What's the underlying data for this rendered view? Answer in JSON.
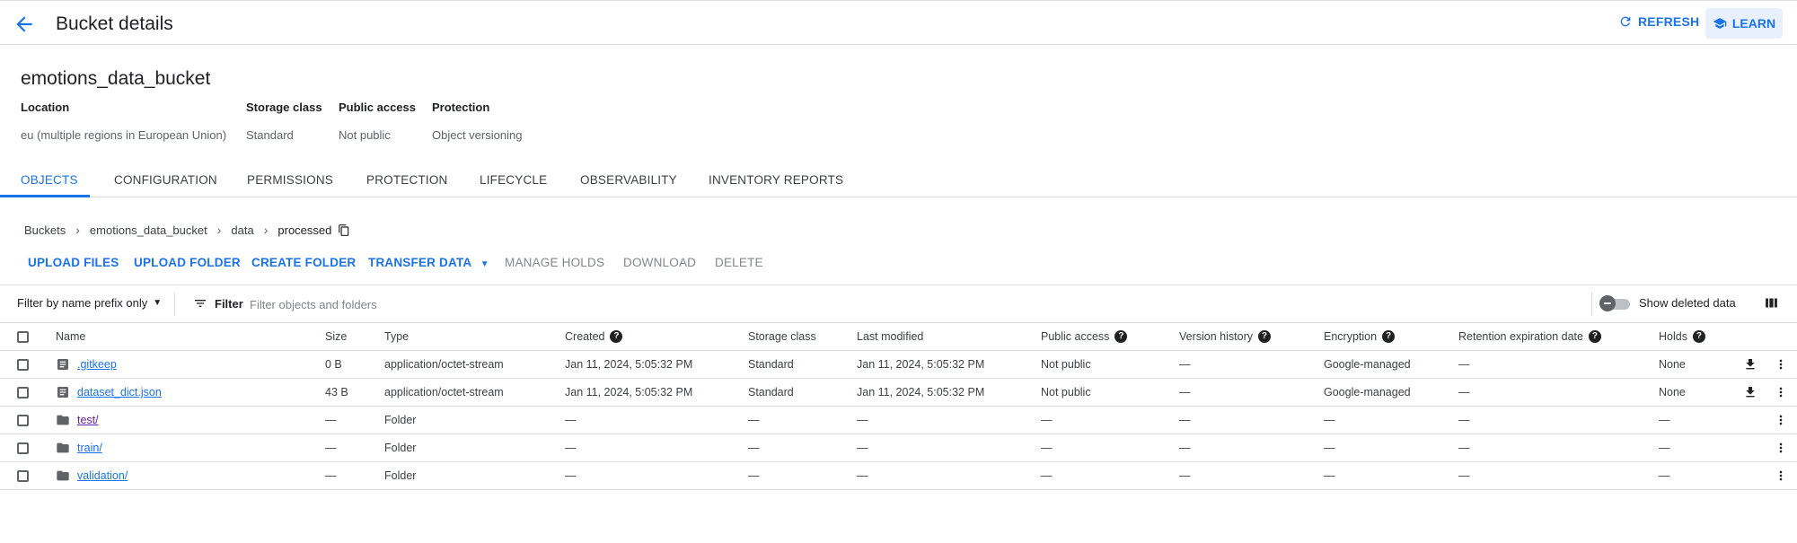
{
  "header": {
    "title": "Bucket details",
    "refresh_label": "REFRESH",
    "learn_label": "LEARN"
  },
  "bucket": {
    "name": "emotions_data_bucket",
    "location_label": "Location",
    "location_value": "eu (multiple regions in European Union)",
    "storage_class_label": "Storage class",
    "storage_class_value": "Standard",
    "public_access_label": "Public access",
    "public_access_value": "Not public",
    "protection_label": "Protection",
    "protection_value": "Object versioning"
  },
  "tabs": [
    {
      "label": "OBJECTS",
      "active": true
    },
    {
      "label": "CONFIGURATION"
    },
    {
      "label": "PERMISSIONS"
    },
    {
      "label": "PROTECTION"
    },
    {
      "label": "LIFECYCLE"
    },
    {
      "label": "OBSERVABILITY"
    },
    {
      "label": "INVENTORY REPORTS"
    }
  ],
  "breadcrumb": [
    "Buckets",
    "emotions_data_bucket",
    "data",
    "processed"
  ],
  "actions": {
    "upload_files": "UPLOAD FILES",
    "upload_folder": "UPLOAD FOLDER",
    "create_folder": "CREATE FOLDER",
    "transfer_data": "TRANSFER DATA",
    "manage_holds": "MANAGE HOLDS",
    "download": "DOWNLOAD",
    "delete": "DELETE"
  },
  "filter": {
    "prefix_label": "Filter by name prefix only",
    "filter_label": "Filter",
    "placeholder": "Filter objects and folders",
    "show_deleted_label": "Show deleted data"
  },
  "table": {
    "columns": [
      "Name",
      "Size",
      "Type",
      "Created",
      "Storage class",
      "Last modified",
      "Public access",
      "Version history",
      "Encryption",
      "Retention expiration date",
      "Holds"
    ],
    "rows": [
      {
        "name": ".gitkeep",
        "kind": "file",
        "size": "0 B",
        "type": "application/octet-stream",
        "created": "Jan 11, 2024, 5:05:32 PM",
        "storage_class": "Standard",
        "last_modified": "Jan 11, 2024, 5:05:32 PM",
        "public_access": "Not public",
        "version_history": "—",
        "encryption": "Google-managed",
        "retention": "—",
        "holds": "None"
      },
      {
        "name": "dataset_dict.json",
        "kind": "file",
        "size": "43 B",
        "type": "application/octet-stream",
        "created": "Jan 11, 2024, 5:05:32 PM",
        "storage_class": "Standard",
        "last_modified": "Jan 11, 2024, 5:05:32 PM",
        "public_access": "Not public",
        "version_history": "—",
        "encryption": "Google-managed",
        "retention": "—",
        "holds": "None"
      },
      {
        "name": "test/",
        "kind": "folder",
        "size": "—",
        "type": "Folder",
        "created": "—",
        "storage_class": "—",
        "last_modified": "—",
        "public_access": "—",
        "version_history": "—",
        "encryption": "—",
        "retention": "—",
        "holds": "—"
      },
      {
        "name": "train/",
        "kind": "folder",
        "size": "—",
        "type": "Folder",
        "created": "—",
        "storage_class": "—",
        "last_modified": "—",
        "public_access": "—",
        "version_history": "—",
        "encryption": "—",
        "retention": "—",
        "holds": "—"
      },
      {
        "name": "validation/",
        "kind": "folder",
        "size": "—",
        "type": "Folder",
        "created": "—",
        "storage_class": "—",
        "last_modified": "—",
        "public_access": "—",
        "version_history": "—",
        "encryption": "—",
        "retention": "—",
        "holds": "—"
      }
    ]
  },
  "colors": {
    "accent": "#1a73e8",
    "visited_link": "#681da8",
    "border": "#dadce0"
  }
}
